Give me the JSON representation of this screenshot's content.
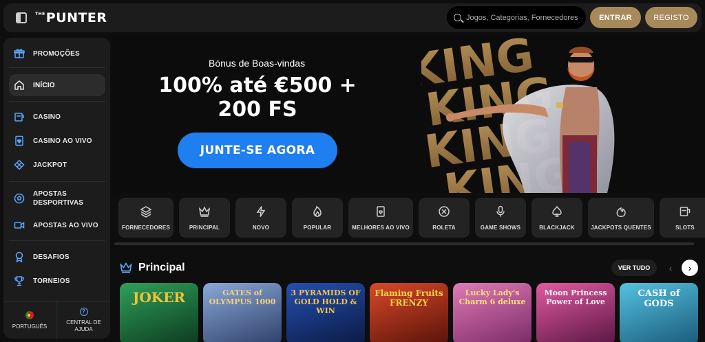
{
  "header": {
    "logo_prefix": "THE",
    "logo_text": "PUNTER",
    "search_placeholder": "Jogos, Categorias, Fornecedores",
    "login_label": "ENTRAR",
    "register_label": "REGISTO"
  },
  "sidebar": {
    "items": [
      {
        "label": "PROMOÇÕES",
        "icon": "gift-icon"
      },
      {
        "label": "INÍCIO",
        "icon": "home-icon",
        "active": true
      },
      {
        "label": "CASINO",
        "icon": "slot-machine-icon"
      },
      {
        "label": "CASINO AO VIVO",
        "icon": "playing-card-icon"
      },
      {
        "label": "JACKPOT",
        "icon": "jackpot-icon"
      },
      {
        "label": "APOSTAS DESPORTIVAS",
        "icon": "football-icon"
      },
      {
        "label": "APOSTAS AO VIVO",
        "icon": "video-icon"
      },
      {
        "label": "DESAFIOS",
        "icon": "medal-icon"
      },
      {
        "label": "TORNEIOS",
        "icon": "trophy-icon"
      }
    ],
    "bottom": {
      "language_label": "PORTUGUÊS",
      "help_label": "CENTRAL DE AJUDA"
    }
  },
  "hero": {
    "subtitle": "Bónus de Boas-vindas",
    "title": "100% até €500 + 200 FS",
    "cta_label": "JUNTE-SE AGORA",
    "art_text": "KING"
  },
  "categories": [
    {
      "label": "FORNECEDORES",
      "icon": "layers-icon"
    },
    {
      "label": "PRINCIPAL",
      "icon": "crown-icon"
    },
    {
      "label": "NOVO",
      "icon": "lightning-icon"
    },
    {
      "label": "POPULAR",
      "icon": "flame-icon"
    },
    {
      "label": "MELHORES AO VIVO",
      "icon": "card-heart-icon"
    },
    {
      "label": "ROLETA",
      "icon": "roulette-icon"
    },
    {
      "label": "GAME SHOWS",
      "icon": "microphone-icon"
    },
    {
      "label": "BLACKJACK",
      "icon": "spade-icon"
    },
    {
      "label": "JACKPOTS QUENTES",
      "icon": "hot-jackpot-icon"
    },
    {
      "label": "SLOTS",
      "icon": "slot-icon"
    }
  ],
  "section": {
    "title": "Principal",
    "view_all_label": "VER TUDO",
    "prev_label": "‹",
    "next_label": "›"
  },
  "games": [
    {
      "title": "JOKER",
      "colors": [
        "#1f6a3a",
        "#0d3b22"
      ]
    },
    {
      "title": "GATES of OLYMPUS 1000",
      "colors": [
        "#6b8fc7",
        "#3b4f7a"
      ]
    },
    {
      "title": "3 PYRAMIDS OF GOLD HOLD & WIN",
      "colors": [
        "#1b3c8c",
        "#0b1d4f"
      ]
    },
    {
      "title": "Flaming Fruits FRENZY",
      "colors": [
        "#b6331c",
        "#5c1208"
      ]
    },
    {
      "title": "Lucky Lady's Charm 6 deluxe",
      "colors": [
        "#d15aa0",
        "#7a2a66"
      ]
    },
    {
      "title": "Moon Princess Power of Love",
      "colors": [
        "#d8468f",
        "#6e1c52"
      ]
    },
    {
      "title": "CASH of GODS",
      "colors": [
        "#37a8c8",
        "#1b5a7a"
      ]
    }
  ]
}
